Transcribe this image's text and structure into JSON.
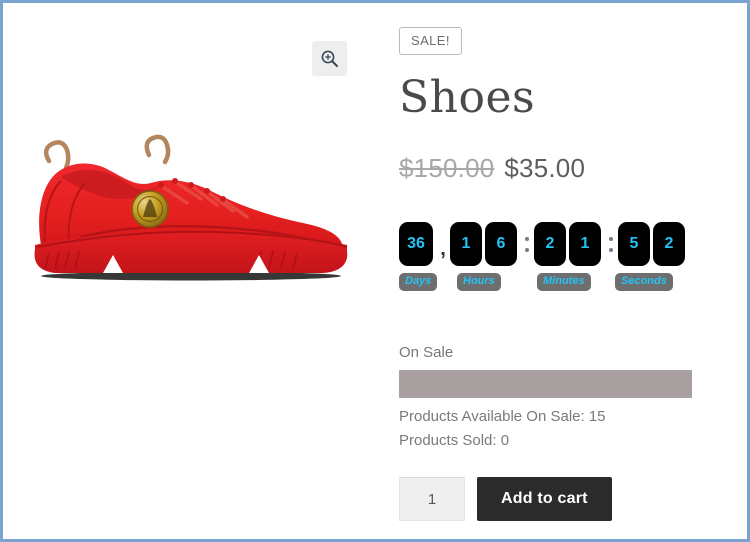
{
  "theme": {
    "frame_border_color": "#7aa3cf",
    "page_bg": "#ffffff",
    "digit_color": "#25c3f5",
    "digit_box_bg": "#000000",
    "label_box_bg": "#6e6e6e",
    "progress_color": "#a89fa0",
    "button_bg": "#2b2b2b",
    "title_color": "#4a4a4a"
  },
  "gallery": {
    "zoom_icon": "magnifier-plus-icon",
    "product_image_alt": "red-sneaker",
    "shoe_color": "#ea2127",
    "shoe_shadow_color": "#1a1a1a",
    "medallion_color": "#c9a227"
  },
  "summary": {
    "sale_badge": "SALE!",
    "title": "Shoes",
    "price": {
      "old": "$150.00",
      "new": "$35.00"
    },
    "countdown": {
      "groups": [
        {
          "key": "days",
          "label": "Days",
          "digits": [
            "36"
          ]
        },
        {
          "key": "hours",
          "label": "Hours",
          "digits": [
            "1",
            "6"
          ]
        },
        {
          "key": "minutes",
          "label": "Minutes",
          "digits": [
            "2",
            "1"
          ]
        },
        {
          "key": "seconds",
          "label": "Seconds",
          "digits": [
            "5",
            "2"
          ]
        }
      ],
      "separator_after_days": ",",
      "separator_colon": ":"
    },
    "stock": {
      "label": "On Sale",
      "progress_percent": 100,
      "available_line": "Products Available On Sale: 15",
      "sold_line": "Products Sold: 0"
    },
    "cart": {
      "quantity_value": "1",
      "quantity_placeholder": "1",
      "add_to_cart_label": "Add to cart"
    }
  }
}
